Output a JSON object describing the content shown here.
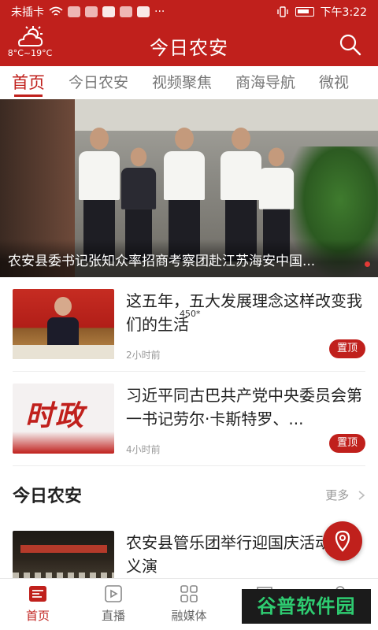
{
  "status_bar": {
    "carrier": "未插卡",
    "more": "···",
    "time": "下午3:22"
  },
  "header": {
    "title": "今日农安",
    "weather_temp": "8°C~19°C"
  },
  "tabs": [
    {
      "label": "首页",
      "active": true
    },
    {
      "label": "今日农安"
    },
    {
      "label": "视频聚焦"
    },
    {
      "label": "商海导航"
    },
    {
      "label": "微视"
    }
  ],
  "banner": {
    "caption": "农安县委书记张知众率招商考察团赴江苏海安中国..."
  },
  "news": [
    {
      "title": "这五年，五大发展理念这样改变我们的生活",
      "time": "2小时前",
      "badge": "置顶"
    },
    {
      "title": "习近平同古巴共产党中央委员会第一书记劳尔·卡斯特罗、...",
      "time": "4小时前",
      "badge": "置顶",
      "thumb_text": "时政"
    }
  ],
  "overlay_label": "450*",
  "section": {
    "title": "今日农安",
    "more": "更多"
  },
  "section_news": [
    {
      "title": "农安县管乐团举行迎国庆活动义演"
    }
  ],
  "bottom_nav": [
    {
      "label": "首页",
      "active": true,
      "icon": "news-icon"
    },
    {
      "label": "直播",
      "icon": "live-icon"
    },
    {
      "label": "融媒体",
      "icon": "grid-icon"
    },
    {
      "label": "互动",
      "icon": "chat-icon"
    },
    {
      "label": "我的",
      "icon": "user-icon"
    }
  ],
  "watermark": "谷普软件园",
  "colors": {
    "brand_red": "#c0201c",
    "text": "#222222",
    "muted": "#999999"
  }
}
